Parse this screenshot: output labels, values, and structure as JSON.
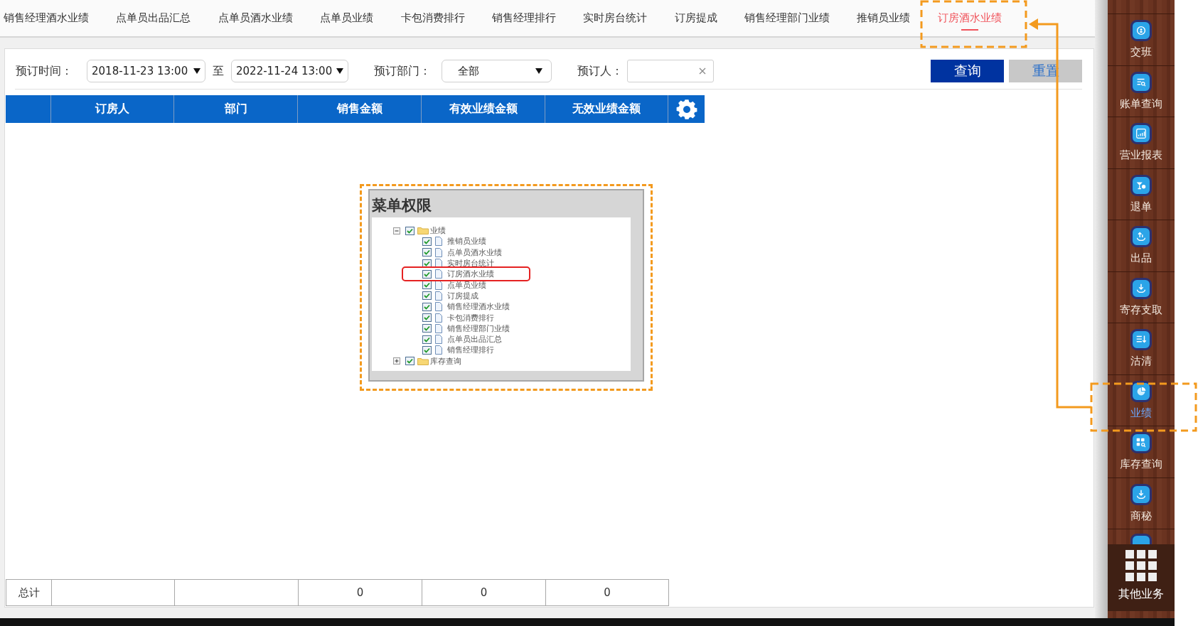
{
  "tabs": [
    {
      "label": "销售经理酒水业绩",
      "selected": false
    },
    {
      "label": "点单员出品汇总",
      "selected": false
    },
    {
      "label": "点单员酒水业绩",
      "selected": false
    },
    {
      "label": "点单员业绩",
      "selected": false
    },
    {
      "label": "卡包消费排行",
      "selected": false
    },
    {
      "label": "销售经理排行",
      "selected": false
    },
    {
      "label": "实时房台统计",
      "selected": false
    },
    {
      "label": "订房提成",
      "selected": false
    },
    {
      "label": "销售经理部门业绩",
      "selected": false
    },
    {
      "label": "推销员业绩",
      "selected": false
    },
    {
      "label": "订房酒水业绩",
      "selected": true
    }
  ],
  "filters": {
    "time_label": "预订时间：",
    "start": "2018-11-23 13:00",
    "to": "至",
    "end": "2022-11-24 13:00",
    "dept_label": "预订部门：",
    "dept": "全部",
    "booker_label": "预订人："
  },
  "buttons": [
    {
      "label": "查询",
      "kind": "primary"
    },
    {
      "label": "重置",
      "kind": "secondary"
    }
  ],
  "table": {
    "columns": [
      "订房人",
      "部门",
      "销售金额",
      "有效业绩金额",
      "无效业绩金额"
    ],
    "totals": {
      "label": "总计",
      "values": [
        "0",
        "0",
        "0"
      ]
    }
  },
  "inset": {
    "title": "菜单权限",
    "tree": [
      {
        "label": "业绩",
        "checked": true,
        "expanded": true,
        "children": [
          {
            "label": "推销员业绩",
            "checked": true,
            "highlighted": false
          },
          {
            "label": "点单员酒水业绩",
            "checked": true,
            "highlighted": false
          },
          {
            "label": "实时房台统计",
            "checked": true,
            "highlighted": false
          },
          {
            "label": "订房酒水业绩",
            "checked": true,
            "highlighted": true
          },
          {
            "label": "点单员业绩",
            "checked": true,
            "highlighted": false
          },
          {
            "label": "订房提成",
            "checked": true,
            "highlighted": false
          },
          {
            "label": "销售经理酒水业绩",
            "checked": true,
            "highlighted": false
          },
          {
            "label": "卡包消费排行",
            "checked": true,
            "highlighted": false
          },
          {
            "label": "销售经理部门业绩",
            "checked": true,
            "highlighted": false
          },
          {
            "label": "点单员出品汇总",
            "checked": true,
            "highlighted": false
          },
          {
            "label": "销售经理排行",
            "checked": true,
            "highlighted": false
          }
        ]
      },
      {
        "label": "库存查询",
        "checked": true,
        "expanded": false
      }
    ]
  },
  "sidebar": {
    "items": [
      {
        "label": "交班",
        "selected": false
      },
      {
        "label": "账单查询",
        "selected": false
      },
      {
        "label": "营业报表",
        "selected": false
      },
      {
        "label": "退单",
        "selected": false
      },
      {
        "label": "出品",
        "selected": false
      },
      {
        "label": "寄存支取",
        "selected": false
      },
      {
        "label": "沽清",
        "selected": false
      },
      {
        "label": "业绩",
        "selected": true
      },
      {
        "label": "库存查询",
        "selected": false
      },
      {
        "label": "商秘",
        "selected": false
      }
    ],
    "more": {
      "label": "其他业务"
    }
  }
}
